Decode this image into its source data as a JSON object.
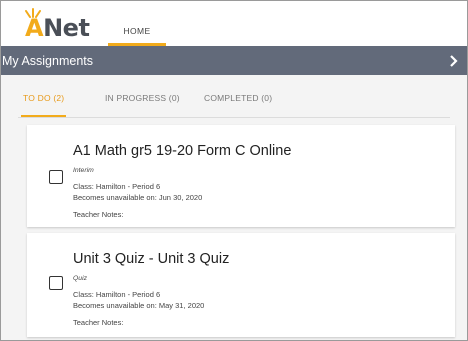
{
  "app": {
    "logo_prefix": "A",
    "logo_suffix": "Net",
    "nav_home": "HOME",
    "accent_color": "#f2ab1b",
    "bar_color": "#626a7a"
  },
  "assignments_bar": {
    "title": "My Assignments",
    "icon": "chevron-right-icon"
  },
  "tabs": [
    {
      "label": "TO DO (2)",
      "active": true
    },
    {
      "label": "IN PROGRESS (0)",
      "active": false
    },
    {
      "label": "COMPLETED (0)",
      "active": false
    }
  ],
  "assignments": [
    {
      "title": "A1 Math gr5 19-20 Form C Online",
      "type": "Interim",
      "class": "Class: Hamilton - Period 6",
      "unavailable": "Becomes unavailable on: Jun 30, 2020",
      "notes": "Teacher Notes:"
    },
    {
      "title": "Unit 3 Quiz - Unit 3 Quiz",
      "type": "Quiz",
      "class": "Class: Hamilton - Period 6",
      "unavailable": "Becomes unavailable on: May 31, 2020",
      "notes": "Teacher Notes:"
    }
  ]
}
